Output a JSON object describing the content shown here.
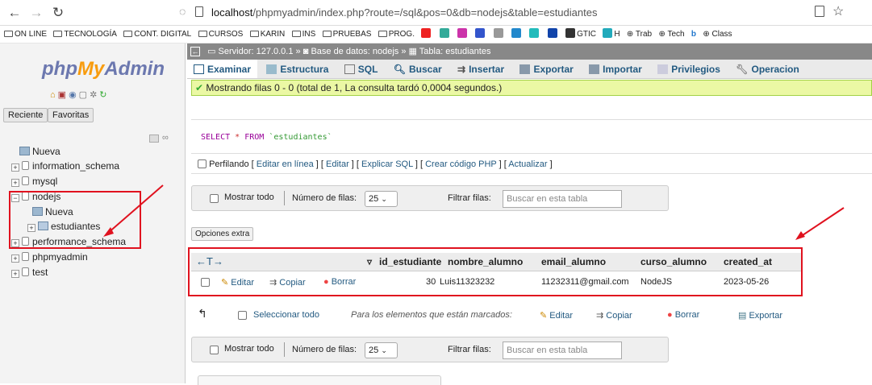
{
  "browser": {
    "url_host": "localhost",
    "url_path": "/phpmyadmin/index.php?route=/sql&pos=0&db=nodejs&table=estudiantes",
    "bookmarks": [
      "ON LINE",
      "TECNOLOGÍA",
      "CONT. DIGITAL",
      "CURSOS",
      "KARIN",
      "INS",
      "PRUEBAS",
      "PROG.",
      "GTIC",
      "H",
      "Trab",
      "Tech",
      "Class"
    ]
  },
  "left": {
    "logo_php": "php",
    "logo_my": "My",
    "logo_admin": "Admin",
    "recent": "Reciente",
    "favorites": "Favoritas",
    "tree": {
      "nueva": "Nueva",
      "information_schema": "information_schema",
      "mysql": "mysql",
      "nodejs": "nodejs",
      "nodejs_nueva": "Nueva",
      "estudiantes": "estudiantes",
      "performance_schema": "performance_schema",
      "phpmyadmin": "phpmyadmin",
      "test": "test"
    }
  },
  "breadcrumb": {
    "server": "Servidor: 127.0.0.1",
    "database": "Base de datos: nodejs",
    "table": "Tabla: estudiantes"
  },
  "tabs": [
    "Examinar",
    "Estructura",
    "SQL",
    "Buscar",
    "Insertar",
    "Exportar",
    "Importar",
    "Privilegios",
    "Operacion"
  ],
  "message": "Mostrando filas 0 - 0 (total de 1, La consulta tardó 0,0004 segundos.)",
  "sql": {
    "keyword": "SELECT",
    "star": "*",
    "from": "FROM",
    "table": "`estudiantes`"
  },
  "profiling": {
    "label": "Perfilando",
    "links": [
      "Editar en línea",
      "Editar",
      "Explicar SQL",
      "Crear código PHP",
      "Actualizar"
    ]
  },
  "nav": {
    "show_all": "Mostrar todo",
    "rows_label": "Número de filas:",
    "rows_value": "25",
    "filter_label": "Filtrar filas:",
    "filter_placeholder": "Buscar en esta tabla"
  },
  "extra_options": "Opciones extra",
  "table": {
    "columns": [
      "id_estudiante",
      "nombre_alumno",
      "email_alumno",
      "curso_alumno",
      "created_at"
    ],
    "row": {
      "edit": "Editar",
      "copy": "Copiar",
      "delete": "Borrar",
      "id_estudiante": "30",
      "nombre_alumno": "Luis11323232",
      "email_alumno": "11232311@gmail.com",
      "curso_alumno": "NodeJS",
      "created_at": "2023-05-26"
    }
  },
  "bulk": {
    "select_all": "Seleccionar todo",
    "for_marked": "Para los elementos que están marcados:",
    "edit": "Editar",
    "copy": "Copiar",
    "delete": "Borrar",
    "export": "Exportar"
  },
  "colors": {
    "annotation_red": "#e0121f",
    "link_blue": "#235a81",
    "success_bg": "#ebf8a4"
  }
}
